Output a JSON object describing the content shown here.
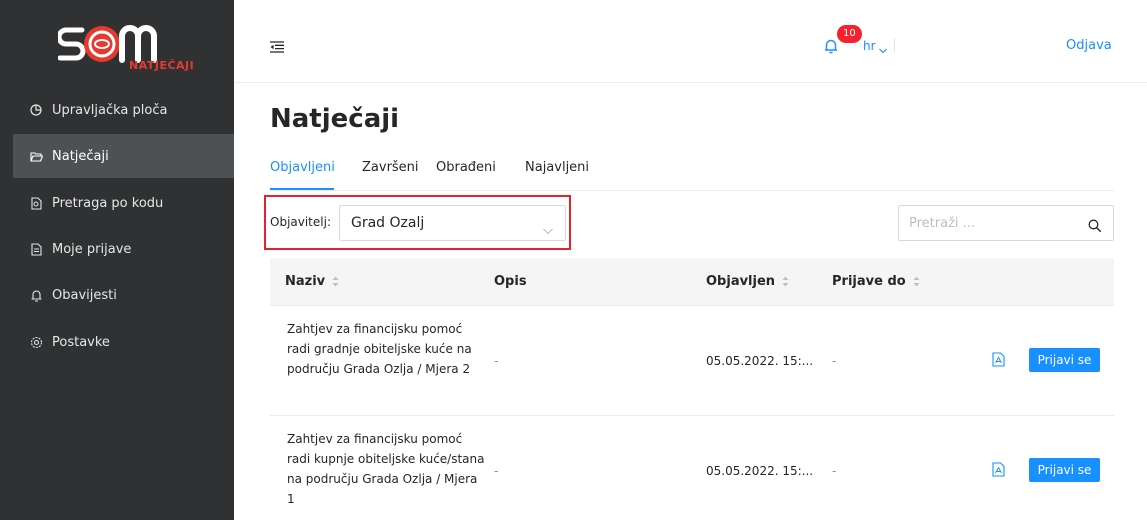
{
  "app": {
    "logo_text": "NATJEČAJI",
    "brand_color": "#e8392f"
  },
  "sidebar": {
    "items": [
      {
        "label": "Upravljačka ploča",
        "icon": "pie-chart-icon",
        "active": false
      },
      {
        "label": "Natječaji",
        "icon": "folder-open-icon",
        "active": true
      },
      {
        "label": "Pretraga po kodu",
        "icon": "file-search-icon",
        "active": false
      },
      {
        "label": "Moje prijave",
        "icon": "file-text-icon",
        "active": false
      },
      {
        "label": "Obavijesti",
        "icon": "bell-icon",
        "active": false
      },
      {
        "label": "Postavke",
        "icon": "settings-icon",
        "active": false
      }
    ]
  },
  "header": {
    "notifications_count": "10",
    "language": "hr",
    "logout_label": "Odjava"
  },
  "main": {
    "title": "Natječaji",
    "tabs": [
      {
        "label": "Objavljeni",
        "active": true
      },
      {
        "label": "Završeni",
        "active": false
      },
      {
        "label": "Obrađeni",
        "active": false
      },
      {
        "label": "Najavljeni",
        "active": false
      }
    ],
    "filter": {
      "label": "Objavitelj:",
      "value": "Grad Ozalj"
    },
    "search": {
      "placeholder": "Pretraži ..."
    },
    "table": {
      "columns": [
        "Naziv",
        "Opis",
        "Objavljen",
        "Prijave do"
      ],
      "rows": [
        {
          "name": "Zahtjev za financijsku pomoć radi gradnje obiteljske kuće na području Grada Ozlja / Mjera 2",
          "description": "-",
          "published": "05.05.2022. 15:...",
          "deadline": "-",
          "apply_label": "Prijavi se"
        },
        {
          "name": "Zahtjev za financijsku pomoć radi kupnje obiteljske kuće/stana na području Grada Ozlja / Mjera 1",
          "description": "-",
          "published": "05.05.2022. 15:...",
          "deadline": "-",
          "apply_label": "Prijavi se"
        }
      ]
    }
  },
  "colors": {
    "accent": "#1890ff",
    "sidebar_bg": "#2f3133",
    "sidebar_active": "#4d5154",
    "badge": "#f5222d",
    "highlight_border": "#e0232e"
  }
}
